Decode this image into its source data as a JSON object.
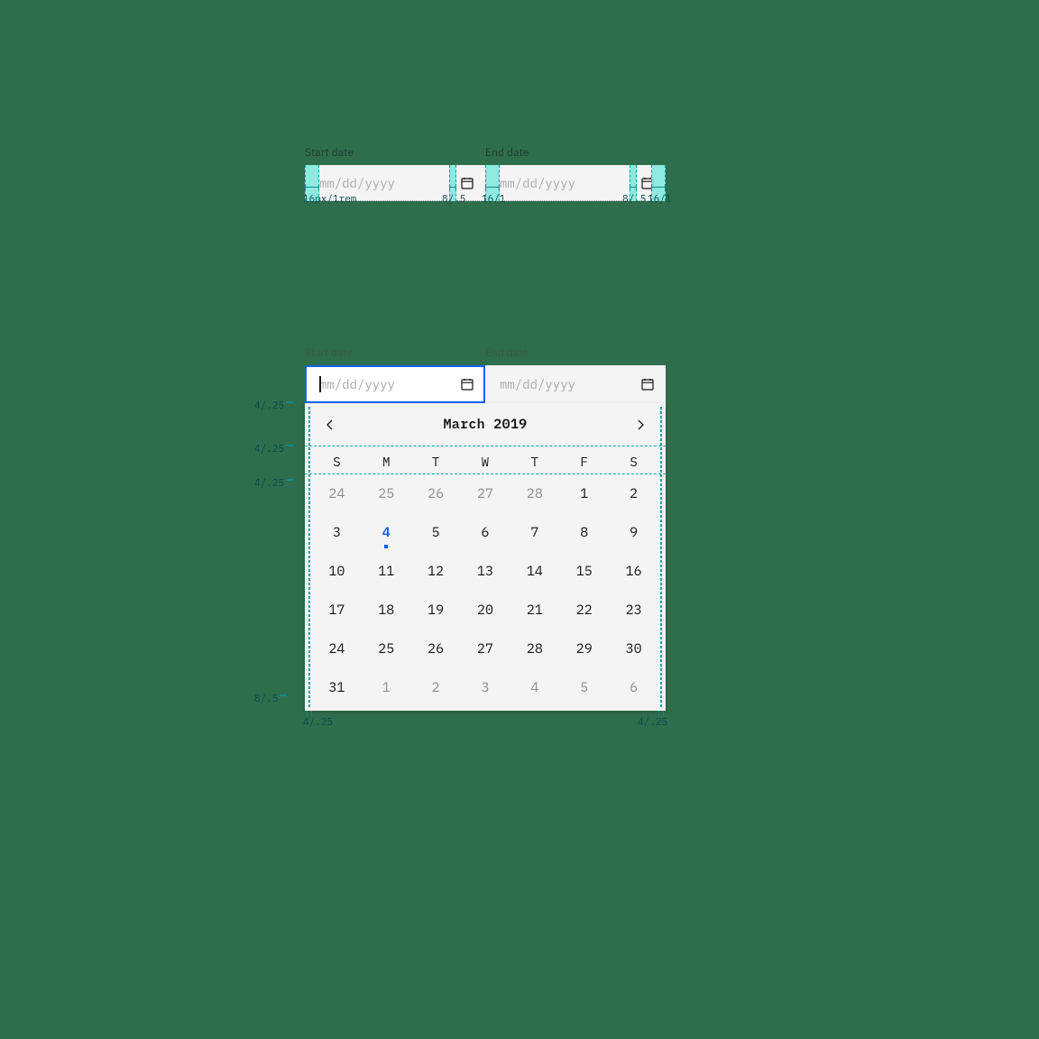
{
  "top": {
    "start_label": "Start date",
    "end_label": "End date",
    "placeholder": "mm/dd/yyyy",
    "dims": {
      "left16": "16px/1rem",
      "mid8_1": "8/.5",
      "gap16": "16/1",
      "mid8_2": "8/.5",
      "right16": "16/1"
    }
  },
  "bottom": {
    "start_label": "Start date",
    "end_label": "End date",
    "placeholder": "mm/dd/yyyy",
    "header_month": "March  2019",
    "dow": [
      "S",
      "M",
      "T",
      "W",
      "T",
      "F",
      "S"
    ],
    "vdims": {
      "top": "4/.25",
      "header": "4/.25",
      "dowline": "4/.25",
      "bottom": "8/.5"
    },
    "hdims": {
      "left": "4/.25",
      "right": "4/.25"
    },
    "days": [
      {
        "n": "24",
        "other": true
      },
      {
        "n": "25",
        "other": true
      },
      {
        "n": "26",
        "other": true
      },
      {
        "n": "27",
        "other": true
      },
      {
        "n": "28",
        "other": true
      },
      {
        "n": "1"
      },
      {
        "n": "2"
      },
      {
        "n": "3"
      },
      {
        "n": "4",
        "today": true
      },
      {
        "n": "5"
      },
      {
        "n": "6"
      },
      {
        "n": "7"
      },
      {
        "n": "8"
      },
      {
        "n": "9"
      },
      {
        "n": "10"
      },
      {
        "n": "11"
      },
      {
        "n": "12"
      },
      {
        "n": "13"
      },
      {
        "n": "14"
      },
      {
        "n": "15"
      },
      {
        "n": "16"
      },
      {
        "n": "17"
      },
      {
        "n": "18"
      },
      {
        "n": "19"
      },
      {
        "n": "20"
      },
      {
        "n": "21"
      },
      {
        "n": "22"
      },
      {
        "n": "23"
      },
      {
        "n": "24"
      },
      {
        "n": "25"
      },
      {
        "n": "26"
      },
      {
        "n": "27"
      },
      {
        "n": "28"
      },
      {
        "n": "29"
      },
      {
        "n": "30"
      },
      {
        "n": "31"
      },
      {
        "n": "1",
        "other": true
      },
      {
        "n": "2",
        "other": true
      },
      {
        "n": "3",
        "other": true
      },
      {
        "n": "4",
        "other": true
      },
      {
        "n": "5",
        "other": true
      },
      {
        "n": "6",
        "other": true
      }
    ]
  }
}
